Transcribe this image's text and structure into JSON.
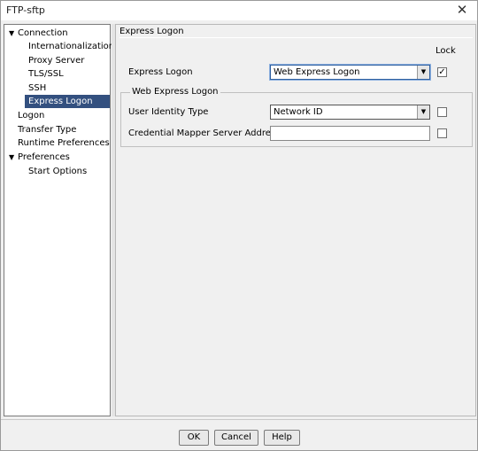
{
  "window": {
    "title": "FTP-sftp",
    "close_glyph": "✕"
  },
  "tree": {
    "items": [
      {
        "label": "Connection",
        "expander": "▼"
      },
      {
        "label": "Internationalization"
      },
      {
        "label": "Proxy Server"
      },
      {
        "label": "TLS/SSL"
      },
      {
        "label": "SSH"
      },
      {
        "label": "Express Logon",
        "selected": true
      },
      {
        "label": "Logon"
      },
      {
        "label": "Transfer Type"
      },
      {
        "label": "Runtime Preferences"
      },
      {
        "label": "Preferences",
        "expander": "▼"
      },
      {
        "label": "Start Options"
      }
    ]
  },
  "panel": {
    "section_title": "Express Logon",
    "lock_header": "Lock",
    "express_logon": {
      "label": "Express Logon",
      "value": "Web Express Logon",
      "locked": true,
      "check_glyph": "✓"
    },
    "group_title": "Web Express Logon",
    "identity_type": {
      "label": "User Identity Type",
      "value": "Network ID",
      "locked": false
    },
    "credential_mapper": {
      "label": "Credential Mapper Server Address",
      "value": "",
      "locked": false
    },
    "dropdown_glyph": "▼"
  },
  "buttons": {
    "ok": "OK",
    "cancel": "Cancel",
    "help": "Help"
  }
}
